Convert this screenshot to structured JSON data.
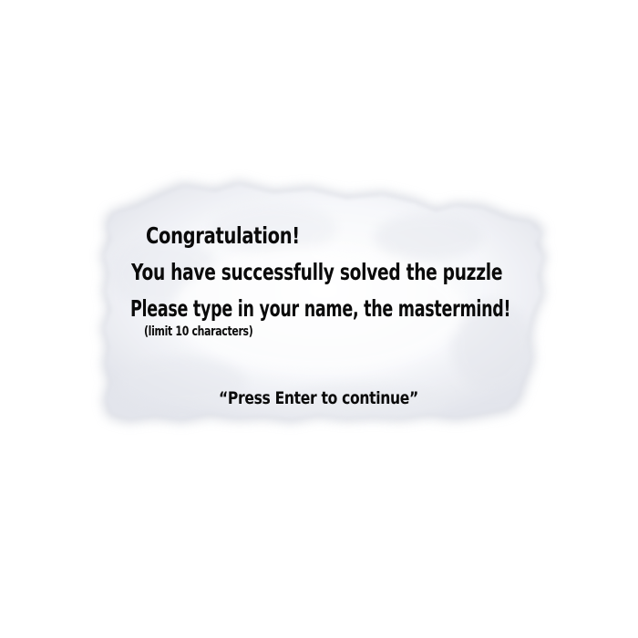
{
  "dialog": {
    "title": "Congratulation!",
    "line1": "You have successfully solved the puzzle",
    "line2": "Please type in your name, the mastermind!",
    "note": "(limit 10 characters)",
    "prompt": "“Press Enter to continue”"
  },
  "colors": {
    "background": "#ffffff",
    "cloud": "#f4f5f8",
    "cloud_shadow": "#c9ccd6",
    "text": "#0a0a0a"
  }
}
